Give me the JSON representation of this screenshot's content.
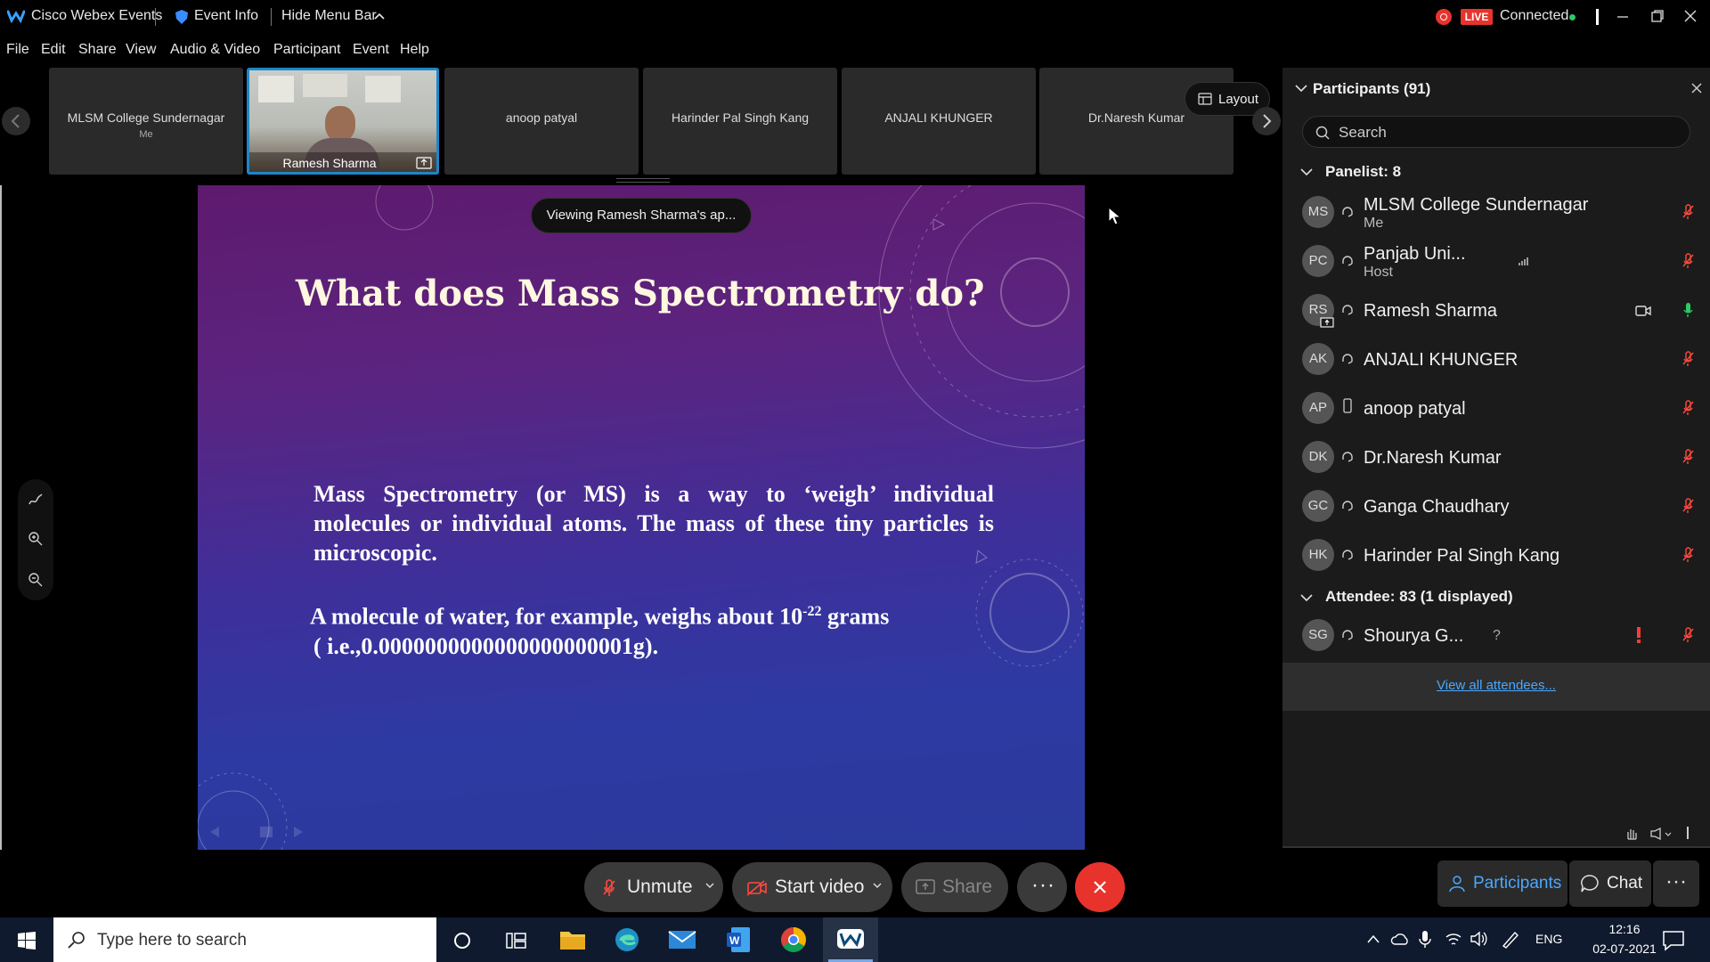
{
  "titlebar": {
    "app_title": "Cisco Webex Events",
    "event_info": "Event Info",
    "hide_menu": "Hide Menu Bar",
    "live_badge": "LIVE",
    "connection": "Connected"
  },
  "menu": [
    "File",
    "Edit",
    "Share",
    "View",
    "Audio & Video",
    "Participant",
    "Event",
    "Help"
  ],
  "filmstrip": {
    "layout_label": "Layout",
    "tiles": [
      {
        "name": "MLSM College Sundernagar",
        "sub": "Me"
      },
      {
        "name": "Ramesh Sharma"
      },
      {
        "name": "anoop patyal"
      },
      {
        "name": "Harinder Pal Singh Kang"
      },
      {
        "name": "ANJALI KHUNGER"
      },
      {
        "name": "Dr.Naresh Kumar"
      }
    ]
  },
  "stage": {
    "viewing_label": "Viewing Ramesh Sharma's ap...",
    "slide_title": "What does Mass Spectrometry do?",
    "para1_lines": [
      "Mass Spectrometry (or MS) is a way to ‘weigh’ individual",
      "molecules or individual atoms. The mass of these tiny particles is",
      "microscopic."
    ],
    "para2_prefix": "A molecule of water, for example, weighs about 10",
    "para2_sup": "-22",
    "para2_suffix": " grams",
    "para2_line2": "( i.e.,0.0000000000000000000001g)."
  },
  "participants": {
    "header": "Participants (91)",
    "search_placeholder": "Search",
    "panelist_header": "Panelist: 8",
    "panelists": [
      {
        "initials": "MS",
        "name": "MLSM College Sundernagar",
        "sub": "Me"
      },
      {
        "initials": "PC",
        "name": "Panjab Uni...",
        "sub": "Host"
      },
      {
        "initials": "RS",
        "name": "Ramesh Sharma"
      },
      {
        "initials": "AK",
        "name": "ANJALI KHUNGER"
      },
      {
        "initials": "AP",
        "name": "anoop patyal"
      },
      {
        "initials": "DK",
        "name": "Dr.Naresh Kumar"
      },
      {
        "initials": "GC",
        "name": "Ganga Chaudhary"
      },
      {
        "initials": "HK",
        "name": "Harinder Pal Singh Kang"
      }
    ],
    "attendee_header": "Attendee: 83 (1 displayed)",
    "attendees": [
      {
        "initials": "SG",
        "name": "Shourya G...",
        "status": "?"
      }
    ],
    "view_all": "View all attendees..."
  },
  "controls": {
    "unmute": "Unmute",
    "start_video": "Start video",
    "share": "Share",
    "participants_tab": "Participants",
    "chat_tab": "Chat"
  },
  "taskbar": {
    "search_placeholder": "Type here to search",
    "lang": "ENG",
    "time": "12:16",
    "date": "02-07-2021"
  }
}
